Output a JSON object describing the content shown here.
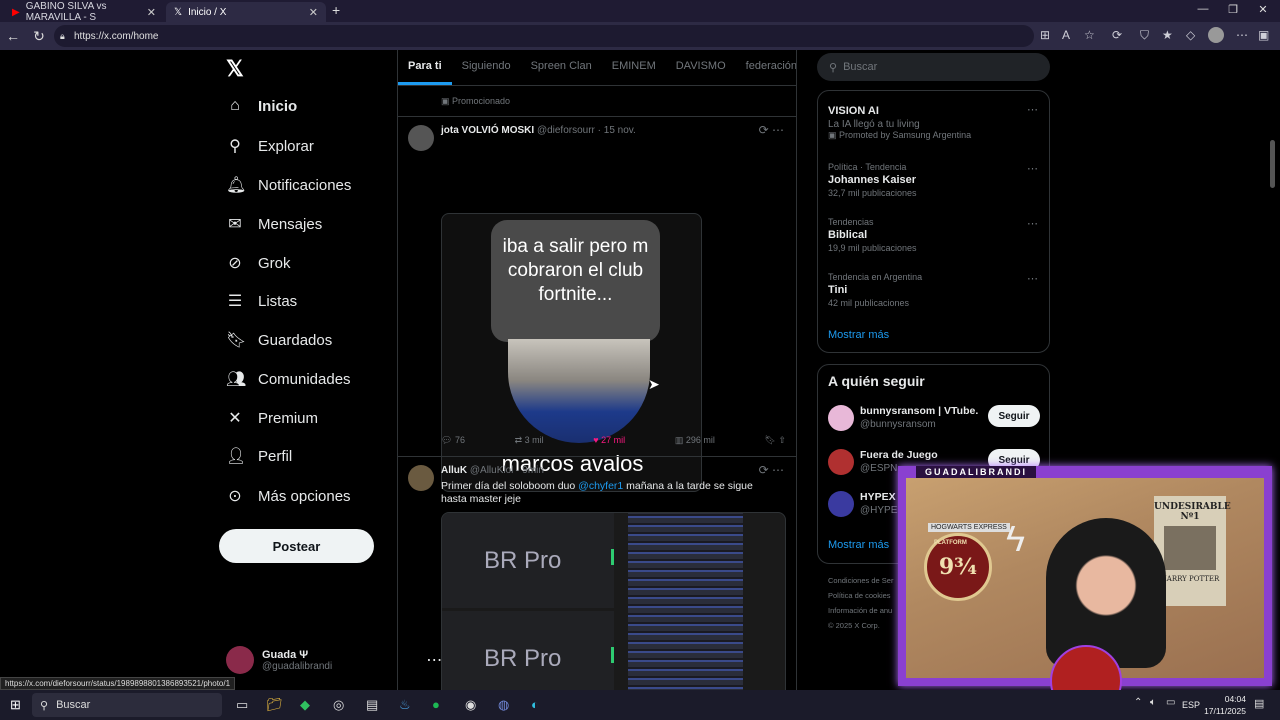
{
  "browser": {
    "tabs": [
      {
        "title": "GABINO SILVA vs MARAVILLA - S",
        "active": false,
        "favicon": "youtube-icon"
      },
      {
        "title": "Inicio / X",
        "active": true,
        "favicon": "x-icon"
      }
    ],
    "url": "https://x.com/home",
    "status_url": "https://x.com/dieforsourr/status/1989898801386893521/photo/1"
  },
  "nav": {
    "items": [
      {
        "label": "Inicio",
        "icon": "home-icon",
        "glyph": "⌂"
      },
      {
        "label": "Explorar",
        "icon": "search-icon",
        "glyph": "⚲"
      },
      {
        "label": "Notificaciones",
        "icon": "bell-icon",
        "glyph": "🔔︎"
      },
      {
        "label": "Mensajes",
        "icon": "mail-icon",
        "glyph": "✉"
      },
      {
        "label": "Grok",
        "icon": "grok-icon",
        "glyph": "⊘"
      },
      {
        "label": "Listas",
        "icon": "list-icon",
        "glyph": "☰"
      },
      {
        "label": "Guardados",
        "icon": "bookmark-icon",
        "glyph": "🔖︎"
      },
      {
        "label": "Comunidades",
        "icon": "people-icon",
        "glyph": "👥︎"
      },
      {
        "label": "Premium",
        "icon": "x-icon",
        "glyph": "✕"
      },
      {
        "label": "Perfil",
        "icon": "person-icon",
        "glyph": "👤︎"
      },
      {
        "label": "Más opciones",
        "icon": "more-circle-icon",
        "glyph": "⊙"
      }
    ],
    "post_label": "Postear",
    "account": {
      "name": "Guada Ψ",
      "handle": "@guadalibrandi"
    }
  },
  "feed": {
    "tabs": [
      "Para ti",
      "Siguiendo",
      "Spreen Clan",
      "EMINEM",
      "DAVISMO",
      "federación de"
    ],
    "promoted_label": "Promocionado",
    "tweets": [
      {
        "name": "jota VOLVIÓ MOSKI",
        "handle": "@dieforsourr · 15 nov.",
        "meme_text": "iba a salir pero m cobraron el club fortnite...",
        "meme_caption": "marcos avalos",
        "replies": "76",
        "retweets": "3 mil",
        "likes": "27 mil",
        "views": "296 mil"
      },
      {
        "name": "AlluK",
        "handle": "@AlluKlol · 9min",
        "text_a": "Primer día del soloboom duo ",
        "mention": "@chyfer1",
        "text_b": " mañana a la tarde se sigue hasta master jeje",
        "image_label": "BR Pro"
      }
    ]
  },
  "sidebar": {
    "search_placeholder": "Buscar",
    "trends": [
      {
        "context": "",
        "title": "VISION AI",
        "count": "La IA llegó a tu living",
        "promo": "Promoted by Samsung Argentina"
      },
      {
        "context": "Política · Tendencia",
        "title": "Johannes Kaiser",
        "count": "32,7 mil publicaciones"
      },
      {
        "context": "Tendencias",
        "title": "Biblical",
        "count": "19,9 mil publicaciones"
      },
      {
        "context": "Tendencia en Argentina",
        "title": "Tini",
        "count": "42 mil publicaciones"
      }
    ],
    "show_more": "Mostrar más",
    "who_title": "A quién seguir",
    "who": [
      {
        "name": "bunnysransom | VTube...",
        "handle": "@bunnysransom",
        "button": "Seguir",
        "color": "#e8b8d8"
      },
      {
        "name": "Fuera de Juego",
        "handle": "@ESPN",
        "button": "Seguir",
        "color": "#b03030"
      },
      {
        "name": "HYPEX",
        "handle": "@HYPEX",
        "button": "",
        "color": "#3a3aa0"
      }
    ],
    "footer": [
      "Condiciones de Ser",
      "Política de cookies",
      "Información de anu",
      "© 2025 X Corp."
    ]
  },
  "stream": {
    "label": "GUADALIBRANDI",
    "poster_93": "9¾",
    "poster_platform": "PLATFORM",
    "poster_express": "HOGWARTS EXPRESS",
    "wanted_a": "UNDESIRABLE",
    "wanted_b": "Nº1",
    "wanted_c": "HARRY POTTER"
  },
  "taskbar": {
    "search": "Buscar",
    "lang": "ESP",
    "time": "04:04",
    "date": "17/11/2025"
  }
}
